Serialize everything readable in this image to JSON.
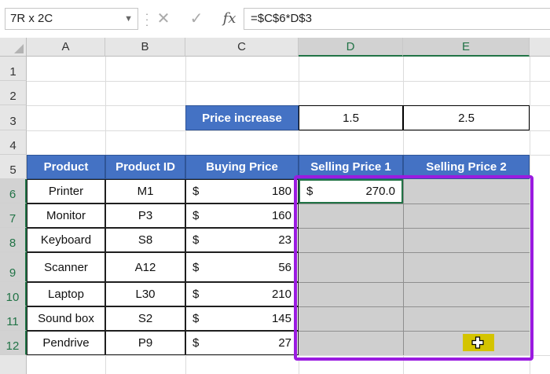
{
  "formula_bar": {
    "name_box": "7R x 2C",
    "cancel_icon": "✕",
    "enter_icon": "✓",
    "fx_label": "fx",
    "formula": "=$C$6*D$3"
  },
  "columns": [
    "A",
    "B",
    "C",
    "D",
    "E"
  ],
  "rows": [
    "1",
    "2",
    "3",
    "4",
    "5",
    "6",
    "7",
    "8",
    "9",
    "10",
    "11",
    "12"
  ],
  "price_increase": {
    "label": "Price increase",
    "d3": "1.5",
    "e3": "2.5"
  },
  "headers": [
    "Product",
    "Product ID",
    "Buying Price",
    "Selling Price 1",
    "Selling Price 2"
  ],
  "table": [
    {
      "product": "Printer",
      "id": "M1",
      "cur": "$",
      "price": "180",
      "sp1_cur": "$",
      "sp1": "270.0"
    },
    {
      "product": "Monitor",
      "id": "P3",
      "cur": "$",
      "price": "160"
    },
    {
      "product": "Keyboard",
      "id": "S8",
      "cur": "$",
      "price": "23"
    },
    {
      "product": "Scanner",
      "id": "A12",
      "cur": "$",
      "price": "56"
    },
    {
      "product": "Laptop",
      "id": "L30",
      "cur": "$",
      "price": "210"
    },
    {
      "product": "Sound box",
      "id": "S2",
      "cur": "$",
      "price": "145"
    },
    {
      "product": "Pendrive",
      "id": "P9",
      "cur": "$",
      "price": "27"
    }
  ],
  "colors": {
    "header_blue": "#4472c4",
    "selection_outline": "#9a1be0",
    "excel_green": "#217346",
    "fill_handle_highlight": "#d4c400"
  }
}
